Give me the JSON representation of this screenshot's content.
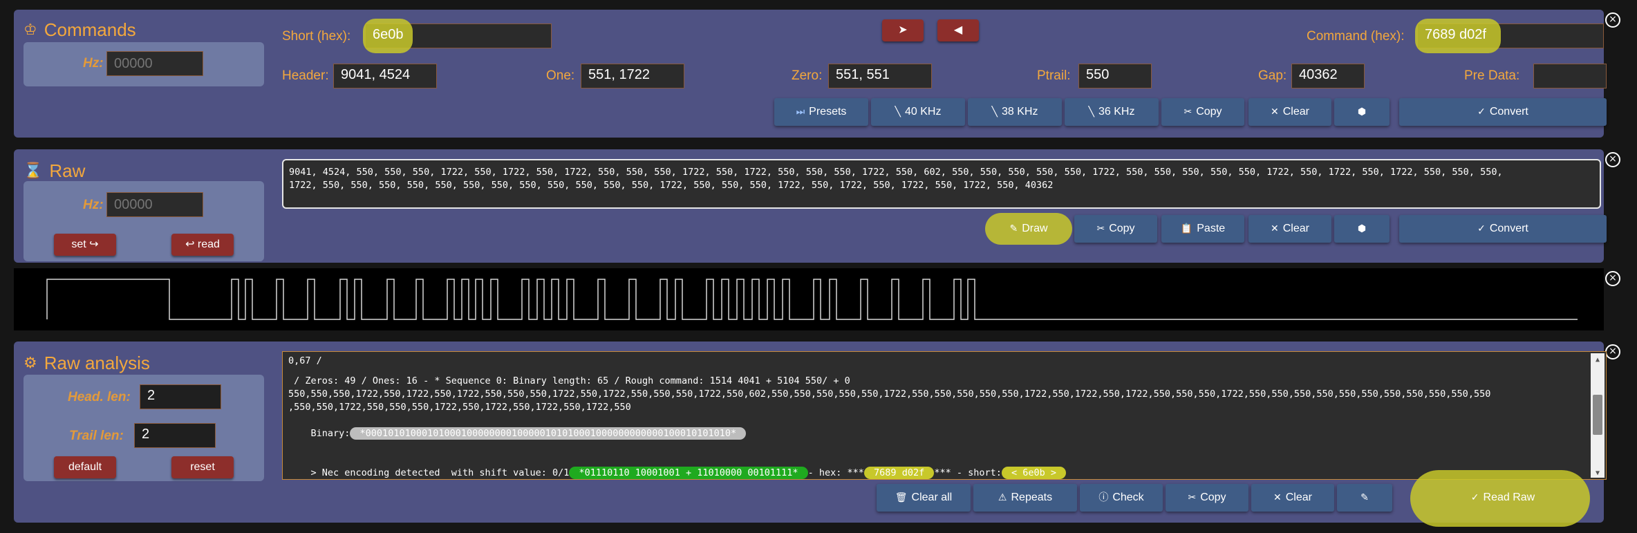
{
  "commands": {
    "title": "Commands",
    "icon": "crown-icon",
    "hz_label": "Hz:",
    "hz_placeholder": "00000",
    "short_label": "Short (hex):",
    "short_value": "6e0b",
    "command_label": "Command (hex):",
    "command_value": "7689 d02f",
    "next_label": "➤",
    "prev_label": "◀",
    "header_label": "Header:",
    "header_value": "9041, 4524",
    "one_label": "One:",
    "one_value": "551, 1722",
    "zero_label": "Zero:",
    "zero_value": "551, 551",
    "ptrail_label": "Ptrail:",
    "ptrail_value": "550",
    "gap_label": "Gap:",
    "gap_value": "40362",
    "predata_label": "Pre Data:",
    "predata_value": "",
    "buttons": {
      "presets": "Presets",
      "khz40": "40 KHz",
      "khz38": "38 KHz",
      "khz36": "36 KHz",
      "copy": "Copy",
      "clear": "Clear",
      "convert": "Convert"
    }
  },
  "raw": {
    "title": "Raw",
    "icon": "hourglass-icon",
    "hz_label": "Hz:",
    "hz_placeholder": "00000",
    "set_label": "set ↪",
    "read_label": "↩ read",
    "text_line1": "9041, 4524, 550, 550, 550, 1722, 550, 1722, 550, 1722, 550, 550, 550, 1722, 550, 1722, 550, 550, 550, 1722, 550, 602, 550, 550, 550, 550, 550, 1722, 550, 550, 550, 550, 550, 1722, 550, 1722, 550, 1722, 550, 550, 550,",
    "text_line2": "1722, 550, 550, 550, 550, 550, 550, 550, 550, 550, 550, 550, 550, 1722, 550, 550, 550, 1722, 550, 1722, 550, 1722, 550, 1722, 550, 40362",
    "buttons": {
      "draw": "Draw",
      "copy": "Copy",
      "paste": "Paste",
      "clear": "Clear",
      "convert": "Convert"
    }
  },
  "analysis": {
    "title": "Raw analysis",
    "icon": "gear-icon",
    "head_label": "Head. len:",
    "head_value": "2",
    "trail_label": "Trail len:",
    "trail_value": "2",
    "default_label": "default",
    "reset_label": "reset",
    "line1": "0,67 /",
    "line2": " / Zeros: 49 / Ones: 16 - * Sequence 0: Binary length: 65 / Rough command: 1514 4041 + 5104 550/ + 0",
    "line3": "550,550,550,1722,550,1722,550,1722,550,550,550,1722,550,1722,550,550,550,1722,550,602,550,550,550,550,550,1722,550,550,550,550,550,1722,550,1722,550,1722,550,550,550,1722,550,550,550,550,550,550,550,550,550,550,550",
    "line4": ",550,550,1722,550,550,550,1722,550,1722,550,1722,550,1722,550",
    "binary_label": "Binary:",
    "binary_value": " *00010101000101000100000000100000101010001000000000000100010101010* ",
    "nec_prefix": "> Nec encoding detected  with shift value: 0/1",
    "nec_bits": " *01110110 10001001 + 11010000 00101111* ",
    "hex_label": "- hex: ***",
    "hex_value": " 7689 d02f ",
    "short_label": "*** - short:",
    "short_value": " < 6e0b > ",
    "buttons": {
      "clear_all": "Clear all",
      "repeats": "Repeats",
      "check": "Check",
      "copy": "Copy",
      "clear": "Clear",
      "read_raw": "Read Raw"
    }
  },
  "colors": {
    "panel": "#4f5283",
    "accent": "#f3a83d",
    "highlight": "#c8c82a",
    "green_pill": "#1faa1f"
  }
}
